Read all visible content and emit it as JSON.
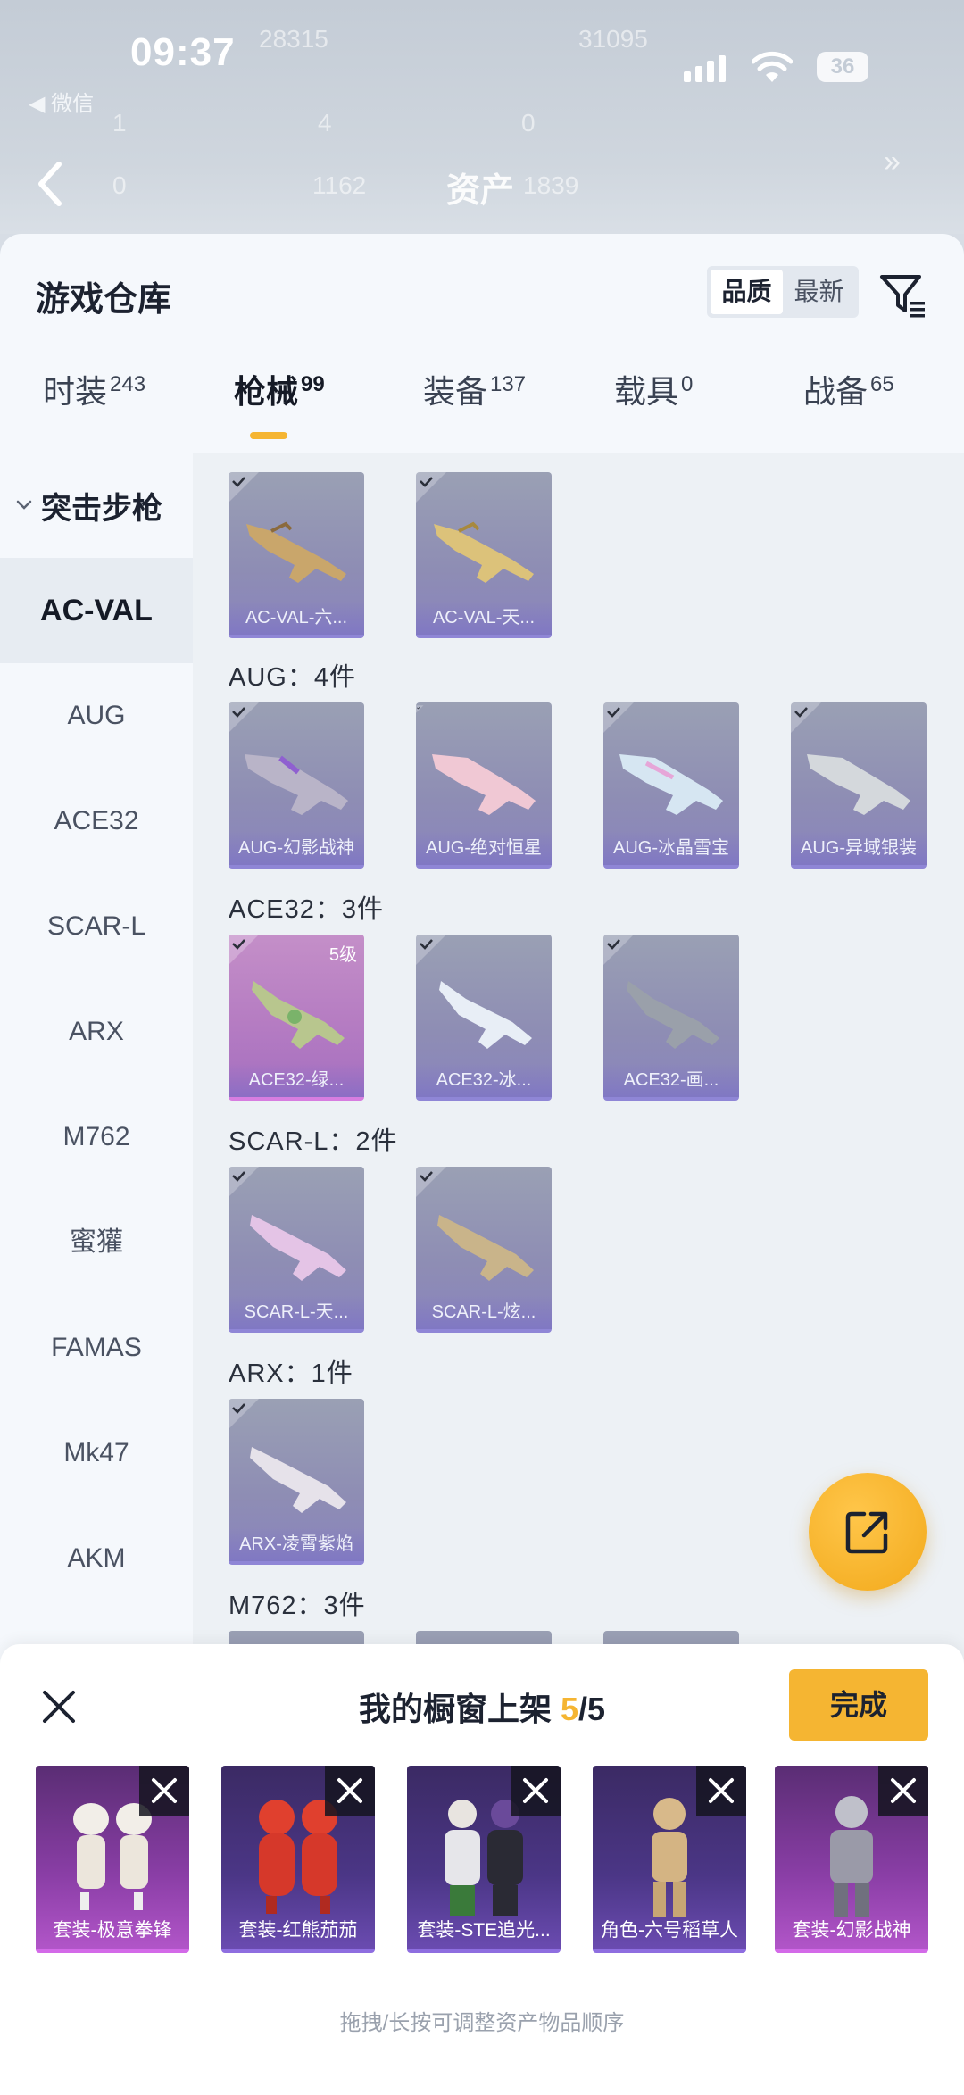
{
  "status_bar": {
    "time": "09:37",
    "back_app": "◀ 微信",
    "battery": "36"
  },
  "background": {
    "stats_row1": [
      "28315",
      "31095"
    ],
    "stats_row2": [
      "1",
      "4",
      "0"
    ],
    "stats_row3": [
      "0",
      "1162",
      "1839"
    ],
    "title": "资产"
  },
  "sheet": {
    "title": "游戏仓库",
    "sort_options": [
      "品质",
      "最新"
    ],
    "tabs": [
      {
        "label": "时装",
        "count": "243"
      },
      {
        "label": "枪械",
        "count": "99"
      },
      {
        "label": "装备",
        "count": "137"
      },
      {
        "label": "载具",
        "count": "0"
      },
      {
        "label": "战备",
        "count": "65"
      }
    ],
    "category_header": "突击步枪",
    "categories": [
      "AC-VAL",
      "AUG",
      "ACE32",
      "SCAR-L",
      "ARX",
      "M762",
      "蜜獾",
      "FAMAS",
      "Mk47",
      "AKM"
    ],
    "groups": {
      "acval": {
        "items": [
          "AC-VAL-六...",
          "AC-VAL-天..."
        ]
      },
      "aug": {
        "label": "AUG：4件",
        "items": [
          "AUG-幻影战神",
          "AUG-绝对恒星",
          "AUG-冰晶雪宝",
          "AUG-异域银装"
        ]
      },
      "ace32": {
        "label": "ACE32：3件",
        "level": "5级",
        "items": [
          "ACE32-绿...",
          "ACE32-冰...",
          "ACE32-画..."
        ]
      },
      "scarl": {
        "label": "SCAR-L：2件",
        "items": [
          "SCAR-L-天...",
          "SCAR-L-炫..."
        ]
      },
      "arx": {
        "label": "ARX：1件",
        "items": [
          "ARX-凌霄紫焰"
        ]
      },
      "m762": {
        "label": "M762：3件"
      }
    }
  },
  "showcase": {
    "title_prefix": "我的橱窗上架 ",
    "count": "5",
    "total": "/5",
    "done": "完成",
    "slots": [
      "套装-极意拳锋",
      "套装-红熊茄茄",
      "套装-STE追光...",
      "角色-六号稻草人",
      "套装-幻影战神"
    ],
    "hint": "拖拽/长按可调整资产物品顺序"
  },
  "colors": {
    "accent": "#f5b532",
    "card_purple": "#8a84bd",
    "card_pink": "#b57cc2"
  },
  "icons": [
    "back-icon",
    "wifi-icon",
    "filter-icon",
    "chevron-down-icon",
    "check-icon",
    "share-icon",
    "close-icon"
  ]
}
